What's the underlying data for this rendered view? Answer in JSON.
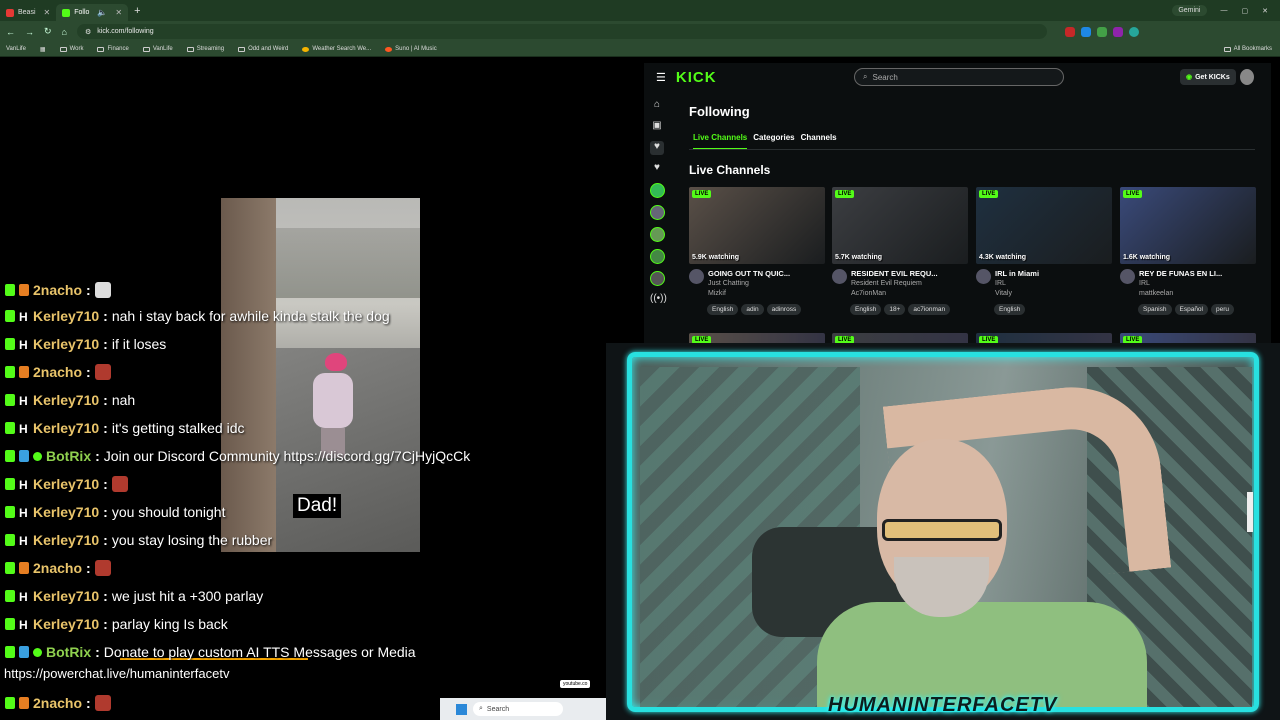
{
  "browser": {
    "tabs": [
      {
        "label": "Beasi",
        "color": "#e53935",
        "active": false
      },
      {
        "label": "Follo",
        "color": "#53fc18",
        "active": true
      }
    ],
    "new_tab": "+",
    "gemini_label": "Gemini",
    "url": "kick.com/following",
    "bookmarks": [
      "VanLife",
      "Work",
      "Finance",
      "VanLife",
      "Streaming",
      "Odd and Weird",
      "Weather Search We...",
      "Suno | AI Music"
    ],
    "all_bookmarks": "All Bookmarks"
  },
  "stream": {
    "video_caption": "Dad!",
    "chat": [
      {
        "user": "2nacho",
        "text": "",
        "emote": "gray"
      },
      {
        "user": "Kerley710",
        "text": "nah i stay back for awhile kinda stalk the dog"
      },
      {
        "user": "Kerley710",
        "text": "if it loses"
      },
      {
        "user": "2nacho",
        "text": "",
        "emote": "red"
      },
      {
        "user": "Kerley710",
        "text": "nah"
      },
      {
        "user": "Kerley710",
        "text": "it's getting stalked idc"
      },
      {
        "user": "BotRix",
        "text": "Join our Discord Community https://discord.gg/7CjHyjQcCk"
      },
      {
        "user": "Kerley710",
        "text": "",
        "emote": "red"
      },
      {
        "user": "Kerley710",
        "text": "you should tonight"
      },
      {
        "user": "Kerley710",
        "text": "you stay losing the rubber"
      },
      {
        "user": "2nacho",
        "text": "",
        "emote": "red"
      },
      {
        "user": "Kerley710",
        "text": "we just hit a +300 parlay"
      },
      {
        "user": "Kerley710",
        "text": "parlay king Is back"
      },
      {
        "user": "BotRix",
        "text": "Donate to play custom AI TTS Messages or Media"
      }
    ],
    "ticker": "https://powerchat.live/humaninterfacetv",
    "bottom_user": "2nacho",
    "sep": ":"
  },
  "kick": {
    "logo": "KICK",
    "search_placeholder": "Search",
    "get_kicks": "Get KICKs",
    "page_title": "Following",
    "tabs": [
      "Live Channels",
      "Categories",
      "Channels"
    ],
    "section_title": "Live Channels",
    "live_badge": "LIVE",
    "cards": [
      {
        "watching": "5.9K watching",
        "title": "GOING OUT TN QUIC...",
        "category": "Just Chatting",
        "channel": "Mizkif",
        "tags": [
          "English",
          "adin",
          "adinross"
        ],
        "thumb": "#5a5048"
      },
      {
        "watching": "5.7K watching",
        "title": "RESIDENT EVIL REQU...",
        "category": "Resident Evil Requiem",
        "channel": "Ac7ionMan",
        "tags": [
          "English",
          "18+",
          "ac7ionman"
        ],
        "thumb": "#3c3e42"
      },
      {
        "watching": "4.3K watching",
        "title": "IRL in Miami",
        "category": "IRL",
        "channel": "Vitaly",
        "tags": [
          "English"
        ],
        "thumb": "#1f3040"
      },
      {
        "watching": "1.6K watching",
        "title": "REY DE FUNAS EN LI...",
        "category": "IRL",
        "channel": "mattkeelan",
        "tags": [
          "Spanish",
          "Español",
          "peru"
        ],
        "thumb": "#3a4a7a"
      }
    ]
  },
  "webcam": {
    "name": "HUMANINTERFACETV",
    "border_color": "#28e0e0"
  },
  "taskbar": {
    "search": "Search",
    "youtube_chip": "youtube.co"
  }
}
